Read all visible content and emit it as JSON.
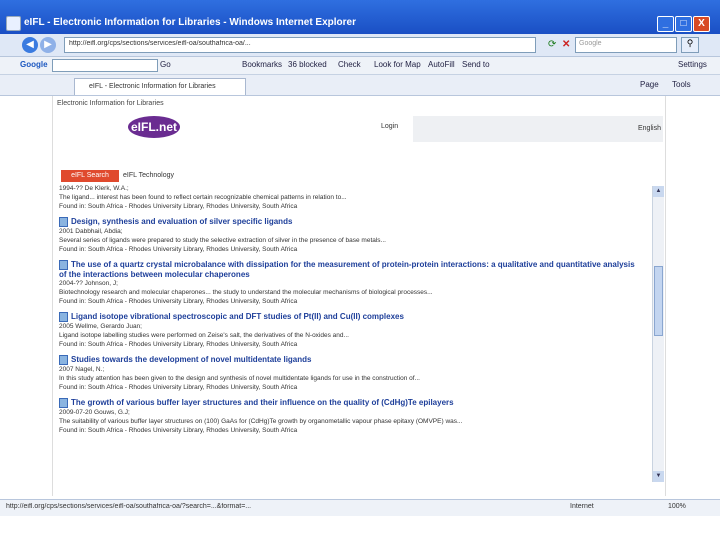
{
  "window": {
    "title": "eIFL - Electronic Information for Libraries - Windows Internet Explorer",
    "minimize": "_",
    "maximize": "□",
    "close": "X"
  },
  "address_bar": {
    "url": "http://eifl.org/cps/sections/services/eifl-oa/southafrica-oa/..."
  },
  "search": {
    "placeholder": "Google"
  },
  "google_toolbar": {
    "logo": "Google",
    "go": "Go",
    "bookmarks": "Bookmarks",
    "blocked": "36 blocked",
    "check": "Check",
    "look_for_map": "Look for Map",
    "autofill": "AutoFill",
    "send_to": "Send to",
    "settings": "Settings"
  },
  "tabs": [
    {
      "label": "eIFL - Electronic Information for Libraries"
    }
  ],
  "commands": {
    "page": "Page",
    "tools": "Tools"
  },
  "page": {
    "site_title": "Electronic Information for Libraries",
    "logo_text": "eIFL.net",
    "login": "Login",
    "language": "English",
    "nav_tab": "eIFL Search",
    "nav_label": "eIFL Technology"
  },
  "results": [
    {
      "title": "",
      "author": "1994-?? De Klerk, W.A.;",
      "abstract": "The ligand... interest has been found to reflect certain recognizable chemical patterns in relation to...",
      "source": "Found in: South Africa - Rhodes University Library, Rhodes University, South Africa"
    },
    {
      "title": "Design, synthesis and evaluation of silver specific ligands",
      "author": "2001 Dabbhail, Abdia;",
      "abstract": "Several series of ligands were prepared to study the selective extraction of silver in the presence of base metals...",
      "source": "Found in: South Africa - Rhodes University Library, Rhodes University, South Africa"
    },
    {
      "title": "The use of a quartz crystal microbalance with dissipation for the measurement of protein-protein interactions: a qualitative and quantitative analysis of the interactions between molecular chaperones",
      "author": "2004-?? Johnson, J;",
      "abstract": "Biotechnology research and molecular chaperones... the study to understand the molecular mechanisms of biological processes...",
      "source": "Found in: South Africa - Rhodes University Library, Rhodes University, South Africa"
    },
    {
      "title": "Ligand isotope vibrational spectroscopic and DFT studies of Pt(II) and Cu(II) complexes",
      "author": "2005 Wellme, Gerardo Juan;",
      "abstract": "Ligand isotope labelling studies were performed on Zeise's salt, the derivatives of the N-oxides and...",
      "source": "Found in: South Africa - Rhodes University Library, Rhodes University, South Africa"
    },
    {
      "title": "Studies towards the development of novel multidentate ligands",
      "author": "2007 Nagel, N.;",
      "abstract": "In this study attention has been given to the design and synthesis of novel multidentate ligands for use in the construction of...",
      "source": "Found in: South Africa - Rhodes University Library, Rhodes University, South Africa"
    },
    {
      "title": "The growth of various buffer layer structures and their influence on the quality of (CdHg)Te epilayers",
      "author": "2009-07-20 Gouws, G.J;",
      "abstract": "The suitability of various buffer layer structures on (100) GaAs for (CdHg)Te growth by organometallic vapour phase epitaxy (OMVPE) was...",
      "source": "Found in: South Africa - Rhodes University Library, Rhodes University, South Africa"
    }
  ],
  "status": {
    "url": "http://eifl.org/cps/sections/services/eifl-oa/southafrica-oa/?search=...&format=...",
    "zone": "Internet",
    "zoom": "100%"
  }
}
